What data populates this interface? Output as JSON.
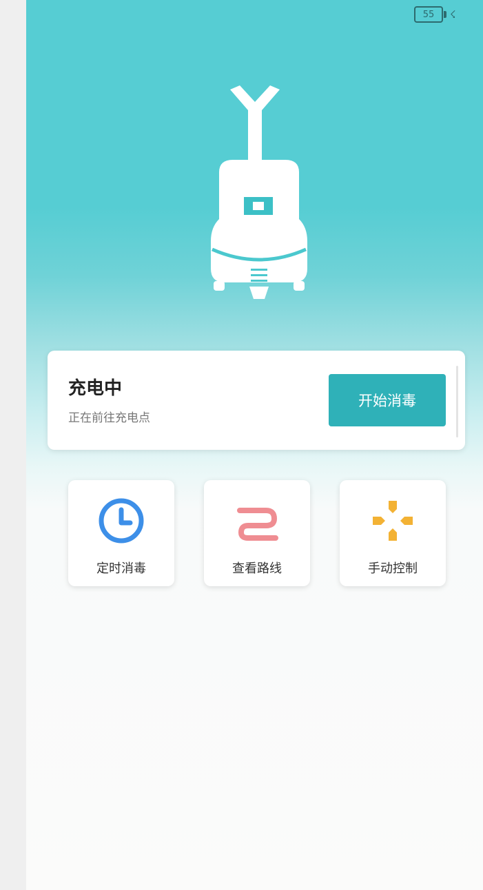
{
  "status_bar": {
    "battery_level": "55",
    "charging_icon": "lightning-bolt-icon"
  },
  "robot": {
    "icon": "disinfection-robot-illustration"
  },
  "status_card": {
    "title": "充电中",
    "subtitle": "正在前往充电点",
    "start_button_label": "开始消毒"
  },
  "actions": [
    {
      "label": "定时消毒",
      "icon": "clock-icon",
      "color": "#3d8fe8"
    },
    {
      "label": "查看路线",
      "icon": "route-icon",
      "color": "#ef8d92"
    },
    {
      "label": "手动控制",
      "icon": "dpad-icon",
      "color": "#f3b234"
    }
  ],
  "colors": {
    "header_teal": "#56cdd3",
    "accent_button": "#2fb1b8"
  }
}
